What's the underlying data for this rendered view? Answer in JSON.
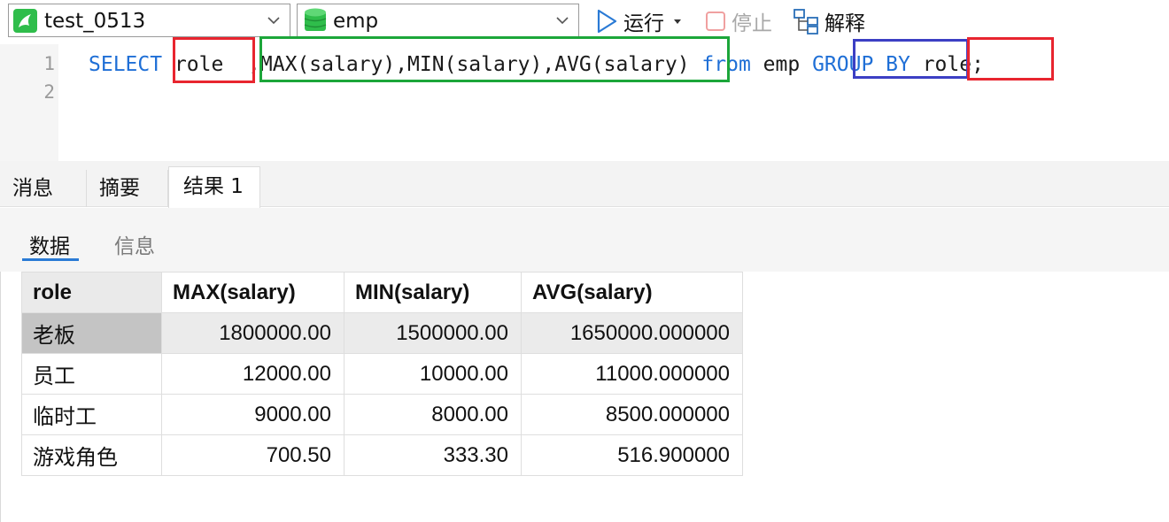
{
  "toolbar": {
    "connection": "test_0513",
    "database": "emp",
    "run_label": "运行",
    "stop_label": "停止",
    "explain_label": "解释"
  },
  "editor": {
    "line_numbers": [
      "1",
      "2"
    ],
    "tokens": {
      "select": "SELECT",
      "role": "role",
      "aggregates": ",MAX(salary),MIN(salary),AVG(salary)",
      "from": "from",
      "table": "emp",
      "group_by": "GROUP BY",
      "role_end": "role;"
    },
    "highlight_colors": {
      "red": "#e8252f",
      "green": "#1ca63a",
      "blue": "#3c3fc4"
    }
  },
  "result_tabs": [
    "消息",
    "摘要",
    "结果 1"
  ],
  "active_tab": "结果 1",
  "sub_tabs": [
    "数据",
    "信息"
  ],
  "active_sub_tab": "数据",
  "grid": {
    "columns": [
      "role",
      "MAX(salary)",
      "MIN(salary)",
      "AVG(salary)"
    ],
    "rows": [
      [
        "老板",
        "1800000.00",
        "1500000.00",
        "1650000.000000"
      ],
      [
        "员工",
        "12000.00",
        "10000.00",
        "11000.000000"
      ],
      [
        "临时工",
        "9000.00",
        "8000.00",
        "8500.000000"
      ],
      [
        "游戏角色",
        "700.50",
        "333.30",
        "516.900000"
      ]
    ],
    "selected_row": 0
  }
}
